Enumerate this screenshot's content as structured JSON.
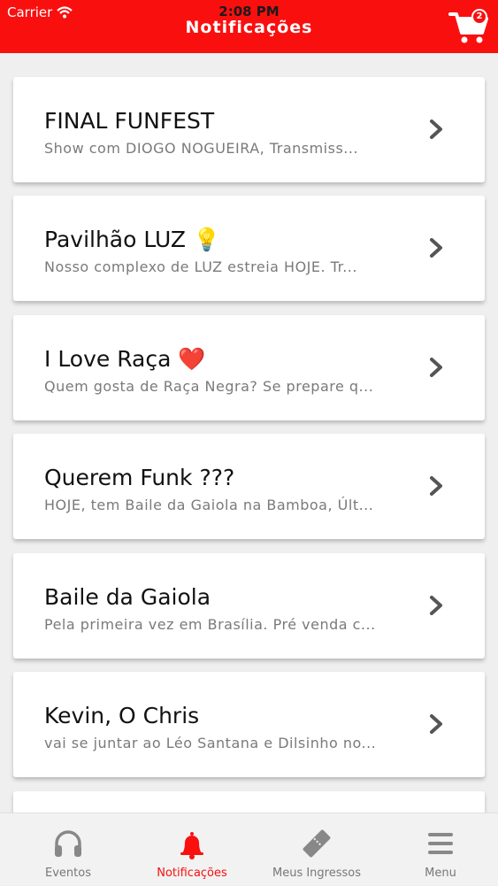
{
  "status_bar": {
    "carrier": "Carrier",
    "time": "2:08 PM"
  },
  "header": {
    "title": "Notificações",
    "cart_count": "2"
  },
  "notifications": [
    {
      "title": "FINAL FUNFEST",
      "subtitle": "Show com DIOGO NOGUEIRA, Transmiss..."
    },
    {
      "title": "Pavilhão LUZ 💡",
      "subtitle": "Nosso complexo de LUZ estreia HOJE. Tr..."
    },
    {
      "title": "I Love Raça ❤️",
      "subtitle": "Quem gosta de Raça Negra? Se prepare q..."
    },
    {
      "title": "Querem Funk ???",
      "subtitle": "HOJE, tem Baile da Gaiola na Bamboa, Últ..."
    },
    {
      "title": "Baile da Gaiola",
      "subtitle": "Pela primeira vez em Brasília. Pré venda c..."
    },
    {
      "title": "Kevin, O Chris",
      "subtitle": "vai se juntar ao Léo Santana e Dilsinho no..."
    }
  ],
  "tabs": [
    {
      "label": "Eventos",
      "icon": "headphones-icon",
      "active": false
    },
    {
      "label": "Notificações",
      "icon": "bell-icon",
      "active": true
    },
    {
      "label": "Meus Ingressos",
      "icon": "ticket-icon",
      "active": false
    },
    {
      "label": "Menu",
      "icon": "menu-icon",
      "active": false
    }
  ],
  "colors": {
    "accent": "#fa0f0f",
    "inactive": "#777777",
    "background": "#efefef"
  }
}
